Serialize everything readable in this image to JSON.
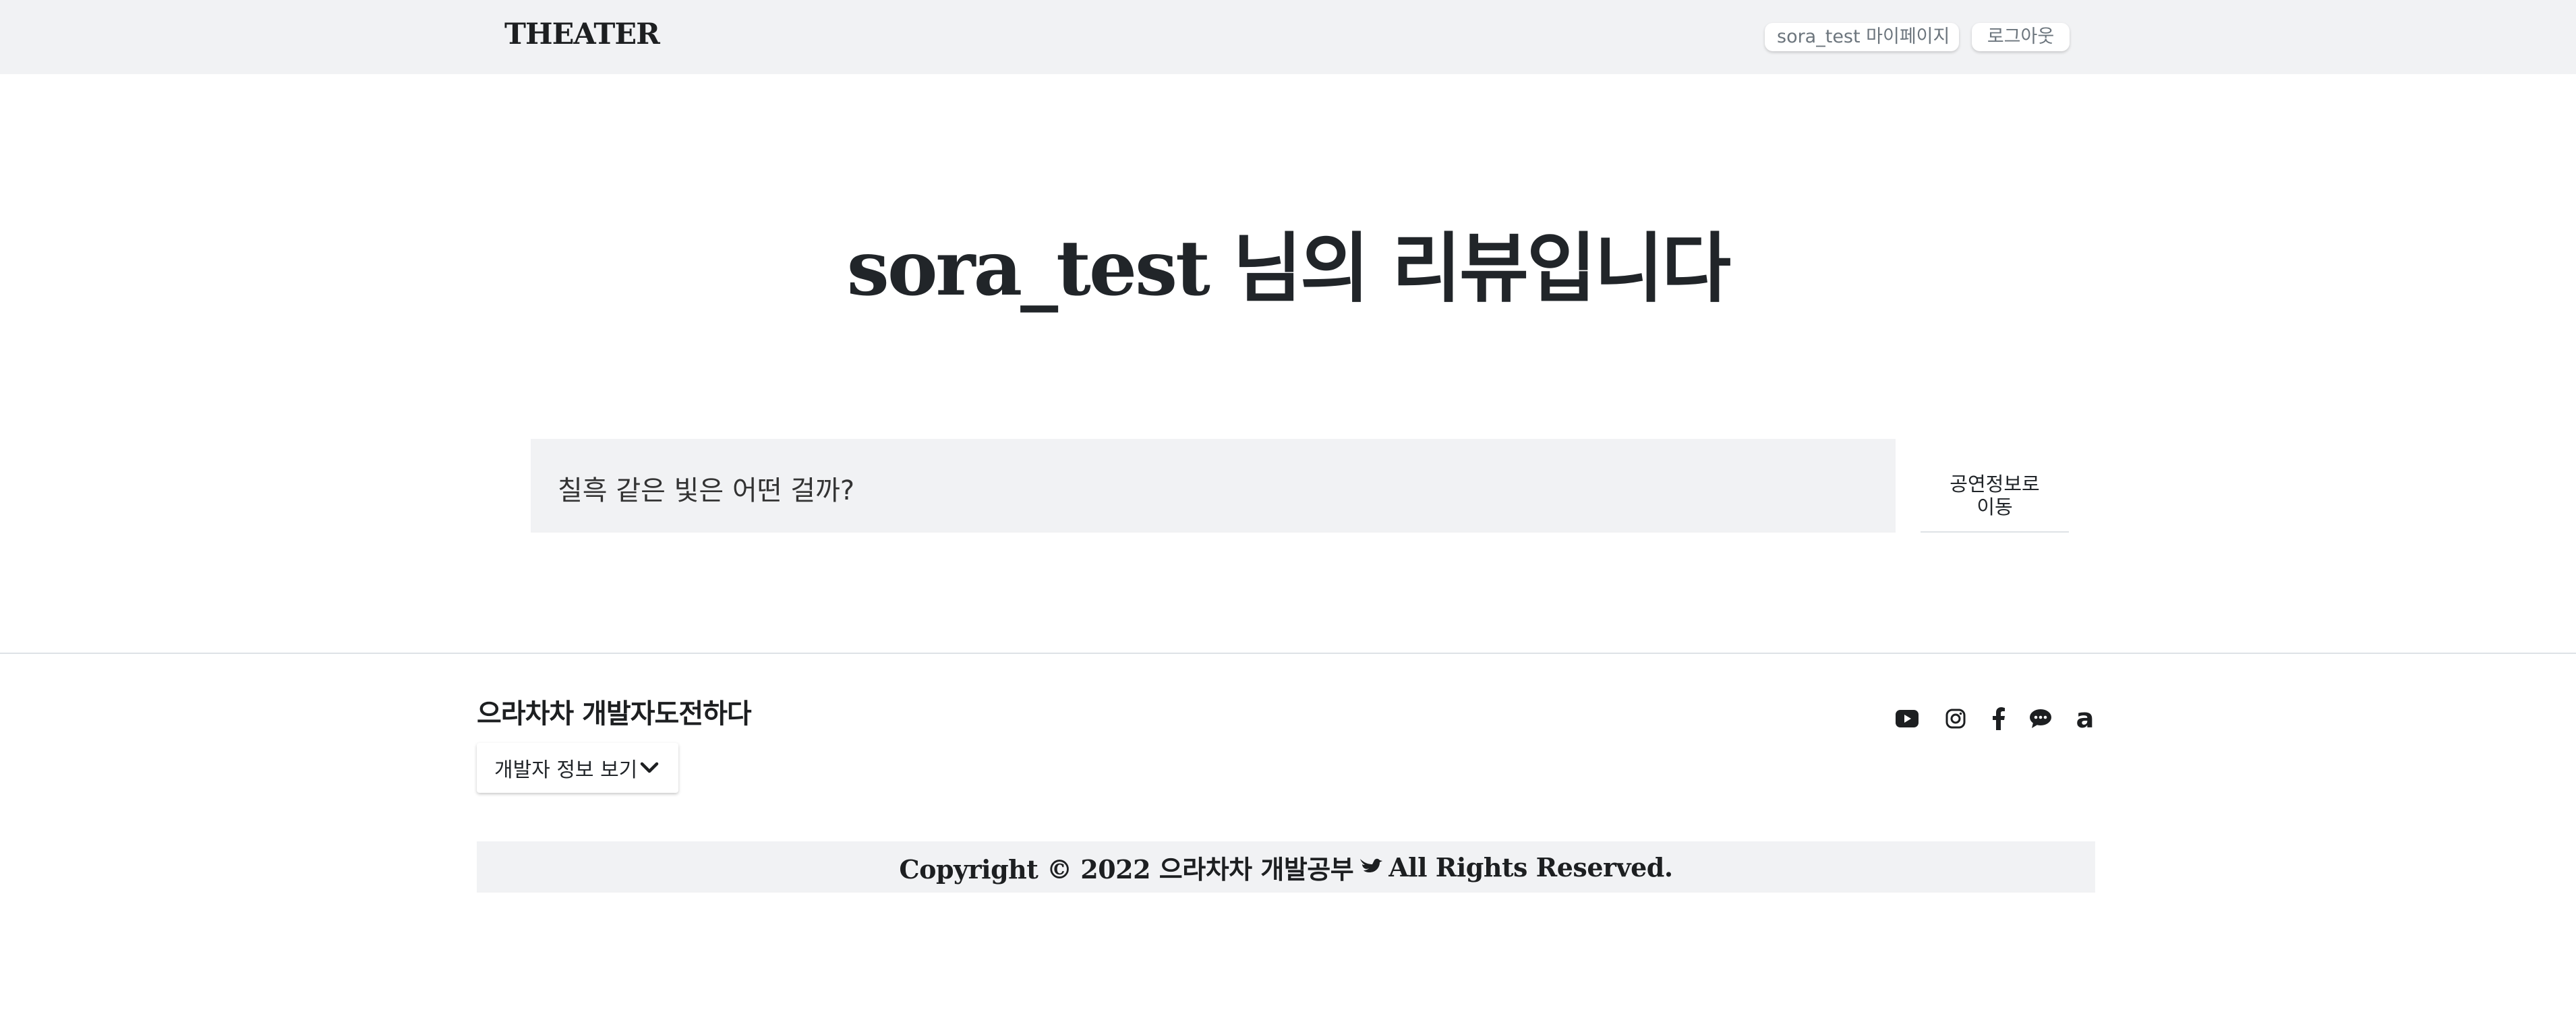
{
  "header": {
    "logo": "THEATER",
    "mypage_label": "sora_test 마이페이지",
    "logout_label": "로그아웃"
  },
  "main": {
    "title": "sora_test 님의 리뷰입니다",
    "review": {
      "text": "칠흑 같은 빛은 어떤 걸까?",
      "goto_line1": "공연정보로",
      "goto_line2": "이동"
    }
  },
  "footer": {
    "brand": "으라차차 개발자도전하다",
    "dev_info_label": "개발자 정보 보기",
    "social_icons": [
      "youtube-icon",
      "instagram-icon",
      "facebook-icon",
      "chat-icon",
      "amazon-icon"
    ],
    "amazon_glyph": "a",
    "copyright_pre": "Copyright © 2022 으라차차 개발공부",
    "copyright_post": "All Rights Reserved."
  },
  "colors": {
    "header_bg": "#f1f2f4",
    "text": "#212529",
    "muted": "#6c757d",
    "review_bg": "#f1f2f4"
  }
}
